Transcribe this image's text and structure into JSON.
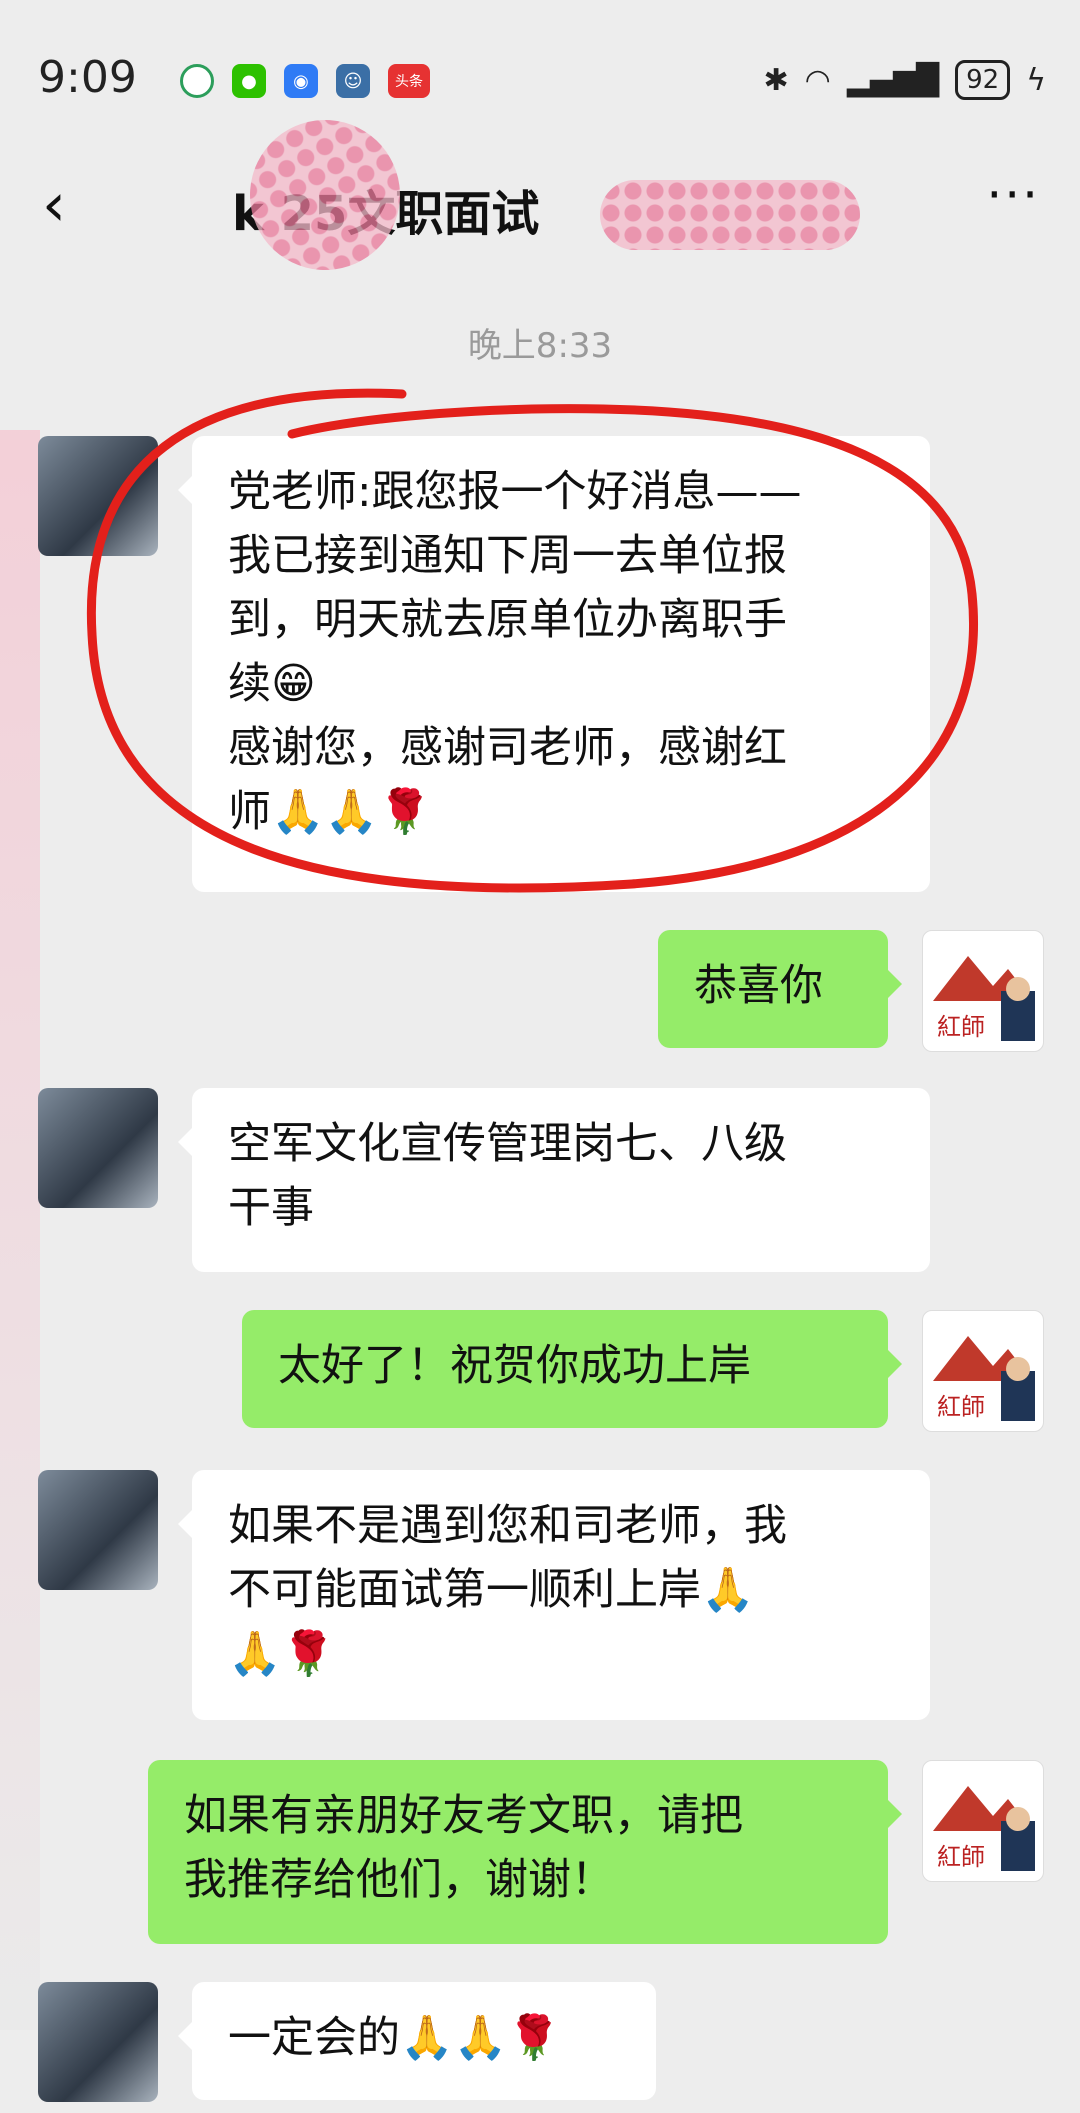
{
  "status_bar": {
    "time": "9:09",
    "battery": "92",
    "app_icons": [
      "search-app-icon",
      "wechat-icon",
      "browser-icon",
      "profile-app-icon",
      "toutiao-icon"
    ],
    "toutiao_label": "头条"
  },
  "header": {
    "title": "k 25文职面试",
    "back_icon": "chevron-left-icon",
    "more_icon": "ellipsis-icon"
  },
  "timestamp": "晚上8:33",
  "messages": [
    {
      "side": "left",
      "lines": [
        "党老师:跟您报一个好消息——",
        "我已接到通知下周一去单位报",
        "到，明天就去原单位办离职手",
        "续😁",
        "感谢您，感谢司老师，感谢红",
        "师🙏🙏🌹"
      ]
    },
    {
      "side": "right",
      "lines": [
        "恭喜你"
      ]
    },
    {
      "side": "left",
      "lines": [
        "空军文化宣传管理岗七、八级",
        "干事"
      ]
    },
    {
      "side": "right",
      "lines": [
        "太好了！祝贺你成功上岸"
      ]
    },
    {
      "side": "left",
      "lines": [
        "如果不是遇到您和司老师，我",
        "不可能面试第一顺利上岸🙏",
        "🙏🌹"
      ]
    },
    {
      "side": "right",
      "lines": [
        "如果有亲朋好友考文职，请把",
        "我推荐给他们，谢谢！"
      ]
    },
    {
      "side": "left",
      "lines": [
        "一定会的🙏🙏🌹"
      ]
    }
  ],
  "avatar_mine_text": "紅師",
  "colors": {
    "bubble_mine": "#95ec69",
    "bubble_other": "#ffffff",
    "background": "#ededed",
    "annotation": "#e3201b"
  }
}
